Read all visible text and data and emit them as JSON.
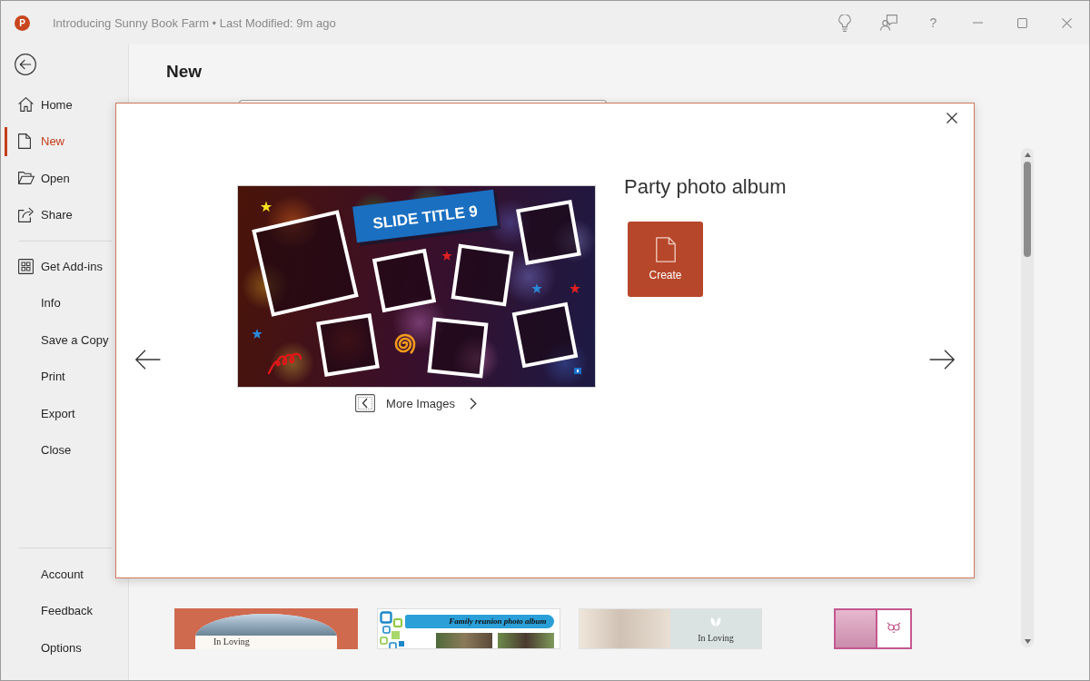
{
  "window": {
    "logo_letter": "P",
    "title": "Introducing Sunny Book Farm • Last Modified: 9m ago",
    "help_label": "?"
  },
  "sidebar": {
    "groups": [
      {
        "items": [
          {
            "label": "Home",
            "selected": false
          },
          {
            "label": "New",
            "selected": true
          },
          {
            "label": "Open",
            "selected": false
          },
          {
            "label": "Share",
            "selected": false
          }
        ]
      },
      {
        "items": [
          {
            "label": "Get Add-ins",
            "selected": false
          },
          {
            "label": "Info",
            "selected": false
          },
          {
            "label": "Save a Copy",
            "selected": false
          },
          {
            "label": "Print",
            "selected": false
          },
          {
            "label": "Export",
            "selected": false
          },
          {
            "label": "Close",
            "selected": false
          }
        ]
      },
      {
        "items": [
          {
            "label": "Account",
            "selected": false
          },
          {
            "label": "Feedback",
            "selected": false
          },
          {
            "label": "Options",
            "selected": false
          }
        ]
      }
    ]
  },
  "page": {
    "heading": "New"
  },
  "templates": [
    {
      "kind": "arch",
      "caption": "In Loving"
    },
    {
      "kind": "banner",
      "caption": "Family reunion photo album"
    },
    {
      "kind": "split",
      "caption": "In Loving"
    },
    {
      "kind": "portrait"
    }
  ],
  "dialog": {
    "title": "Party photo album",
    "create_label": "Create",
    "more_images_label": "More Images",
    "slide": {
      "title": "SLIDE TITLE 9"
    }
  }
}
